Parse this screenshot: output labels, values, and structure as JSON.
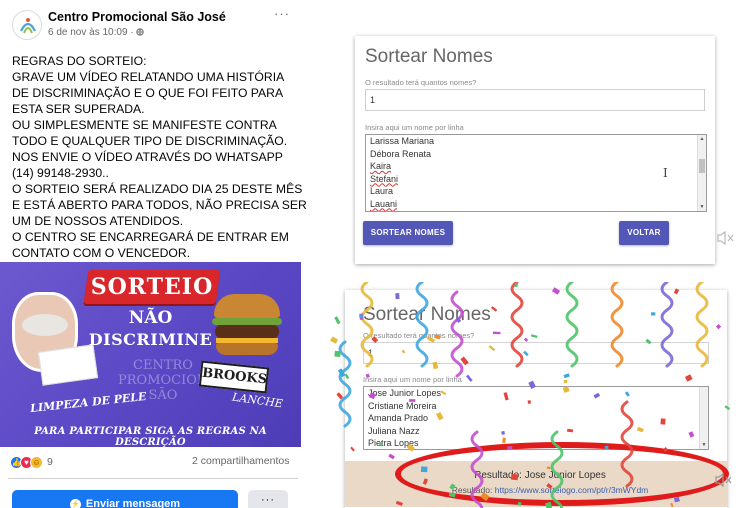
{
  "post": {
    "page_name": "Centro Promocional São José",
    "meta": "6 de nov às 10:09 · ",
    "more": "···",
    "body_lines": [
      "REGRAS DO SORTEIO:",
      "GRAVE UM VÍDEO RELATANDO UMA HISTÓRIA",
      "DE DISCRIMINAÇÃO E O QUE FOI FEITO PARA",
      "ESTA SER SUPERADA.",
      "OU SIMPLESMENTE SE MANIFESTE CONTRA",
      "TODO E QUALQUER TIPO DE DISCRIMINAÇÃO.",
      "NOS ENVIE O VÍDEO ATRAVÉS DO WHATSAPP",
      "(14) 99148-2930..",
      "O SORTEIO SERÁ REALIZADO DIA 25 DESTE MÊS",
      "E ESTÁ ABERTO PARA TODOS, NÃO PRECISA SER",
      "UM DE NOSSOS ATENDIDOS.",
      "O CENTRO SE ENCARREGARÁ DE ENTRAR EM",
      "CONTATO COM O VENCEDOR."
    ],
    "image": {
      "sorteio": "SORTEIO",
      "nao": "NÃO",
      "discrimine": "DISCRIMINE",
      "centro_watermark": "CENTRO PROMOCIONAL SÃO",
      "limpeza": "LIMPEZA DE PELE",
      "brooks": "BROOKS",
      "lanche": "LANCHE",
      "bottom_text": "PARA PARTICIPAR SIGA AS REGRAS NA DESCRIÇÃO"
    },
    "reaction_count": "9",
    "shares": "2 compartilhamentos",
    "send_button": "Enviar mensagem",
    "more_button": "···"
  },
  "sorter_top": {
    "title": "Sortear Nomes",
    "count_label": "O resultado terá quantos nomes?",
    "count_value": "1",
    "names_label": "Insira aqui um nome por linha",
    "names": [
      "Larissa Mariana",
      "Débora Renata",
      "Kaira",
      "Stefani",
      "Laura",
      "Lauani"
    ],
    "draw_button": "SORTEAR NOMES",
    "back_button": "VOLTAR"
  },
  "sorter_bottom": {
    "title": "Sortear Nomes",
    "count_label": "O resultado terá quantos nomes?",
    "count_value": "1",
    "names_label": "Insira aqui um nome por linha",
    "names": [
      "Jose Junior Lopes",
      "Cristiane Moreira",
      "Amanda Prado",
      "Juliana Nazz",
      "Pietra Lopes"
    ],
    "result_prefix": "Resultado",
    "result_name": "Jose Junior Lopes",
    "result_link_label": "Resultado:",
    "result_url": "https://www.sorteiogo.com/pt/r/3mWYdm"
  },
  "colors": {
    "facebook_blue": "#1877f2",
    "button_purple": "#5257b8",
    "promo_purple": "#5a47c4",
    "sorteio_red": "#d8262b",
    "highlight_red": "#e01b1b"
  }
}
